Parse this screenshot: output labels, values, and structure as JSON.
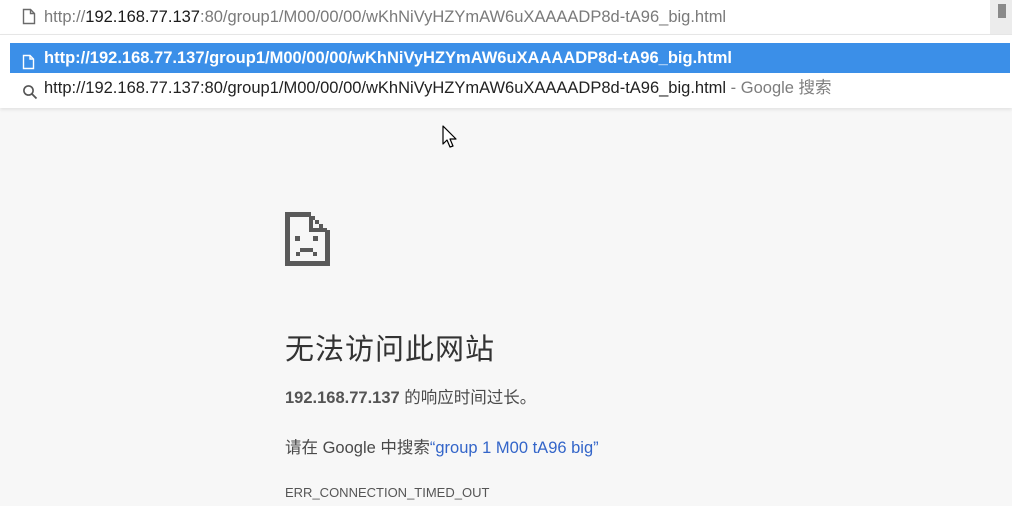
{
  "omnibox": {
    "url_prefix": "http://",
    "url_host": "192.168.77.137",
    "url_rest": ":80/group1/M00/00/00/wKhNiVyHZYmAW6uXAAAADP8d-tA96_big.html",
    "page_icon": "page-icon"
  },
  "suggestions": {
    "selected_text": "http://192.168.77.137/group1/M00/00/00/wKhNiVyHZYmAW6uXAAAADP8d-tA96_big.html",
    "search_text": "http://192.168.77.137:80/group1/M00/00/00/wKhNiVyHZYmAW6uXAAAADP8d-tA96_big.html",
    "search_hint": " - Google 搜索",
    "selected_color": "#3b8fe8"
  },
  "error": {
    "title": "无法访问此网站",
    "ip": "192.168.77.137",
    "desc_suffix": " 的响应时间过长。",
    "suggest_prefix": "请在 Google 中搜索",
    "suggest_open_quote": "“",
    "suggest_link": "group 1 M00 tA96 big",
    "suggest_close_quote": "”",
    "code": "ERR_CONNECTION_TIMED_OUT",
    "link_color": "#3365c9",
    "icon": "sad-page-icon"
  }
}
